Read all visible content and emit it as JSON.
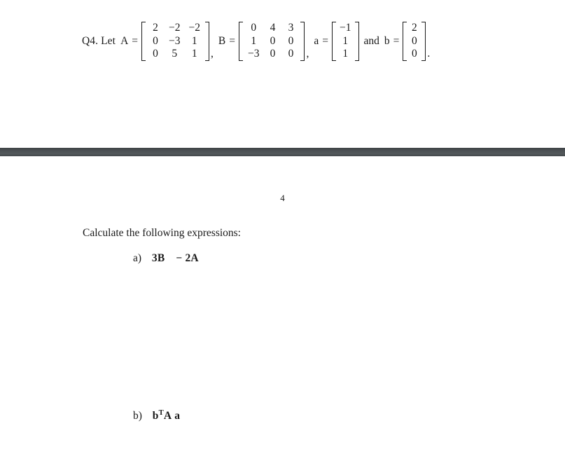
{
  "document": {
    "question": {
      "label": "Q4. Let",
      "equals": "=",
      "comma": ",",
      "period": ".",
      "and_word": "and",
      "matrix_a": {
        "name": "A",
        "rows": [
          [
            "2",
            "−2",
            "−2"
          ],
          [
            "0",
            "−3",
            "1"
          ],
          [
            "0",
            "5",
            "1"
          ]
        ]
      },
      "matrix_b": {
        "name": "B",
        "rows": [
          [
            "0",
            "4",
            "3"
          ],
          [
            "1",
            "0",
            "0"
          ],
          [
            "−3",
            "0",
            "0"
          ]
        ]
      },
      "vector_a": {
        "name": "a",
        "rows": [
          [
            "−1"
          ],
          [
            "1"
          ],
          [
            "1"
          ]
        ]
      },
      "vector_b": {
        "name": "b",
        "rows": [
          [
            "2"
          ],
          [
            "0"
          ],
          [
            "0"
          ]
        ]
      }
    },
    "page_number": "4",
    "prompt": "Calculate the following expressions:",
    "items": [
      {
        "marker": "a)",
        "expression_parts": {
          "first": "3B",
          "operator": "−",
          "second": "2A"
        }
      },
      {
        "marker": "b)",
        "expression_parts": {
          "base": "b",
          "superscript": "T",
          "matrix": "A",
          "vector": "a"
        }
      }
    ],
    "separator_color": "#4c5154"
  }
}
